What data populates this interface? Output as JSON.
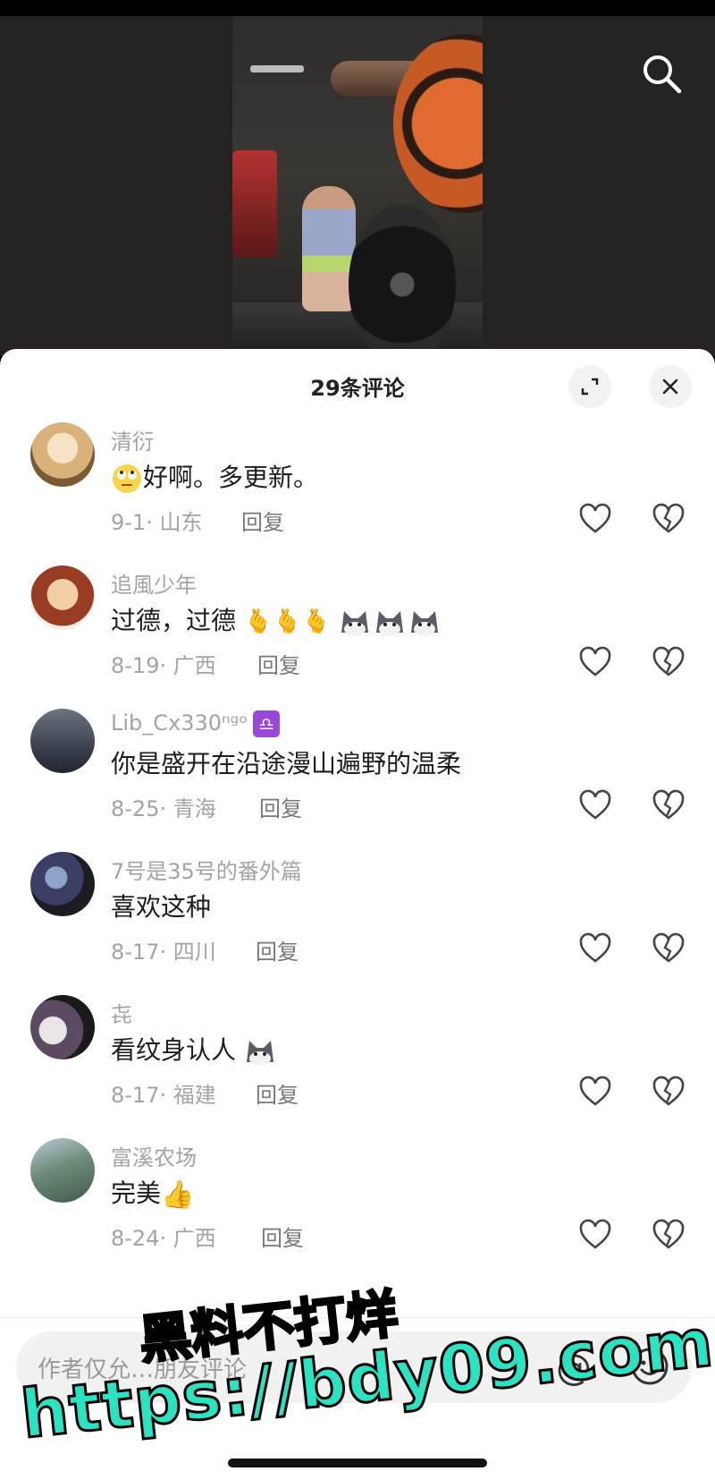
{
  "video": {
    "description_icon": "search-icon"
  },
  "sheet": {
    "title": "29条评论"
  },
  "comments": [
    {
      "username": "清衍",
      "text": "好啊。多更新。",
      "date": "9-1",
      "location": "山东",
      "reply": "回复"
    },
    {
      "username": "追風少年",
      "text": "过德，过德",
      "date": "8-19",
      "location": "广西",
      "reply": "回复"
    },
    {
      "username": "Lib_Cx330ⁿᵍᵒ",
      "text": "你是盛开在沿途漫山遍野的温柔",
      "date": "8-25",
      "location": "青海",
      "reply": "回复",
      "badge": "♎"
    },
    {
      "username": "7号是35号的番外篇",
      "text": "喜欢这种",
      "date": "8-17",
      "location": "四川",
      "reply": "回复"
    },
    {
      "username": "㐂",
      "text": "看纹身认人",
      "date": "8-17",
      "location": "福建",
      "reply": "回复"
    },
    {
      "username": "富溪农场",
      "text": "完美",
      "date": "8-24",
      "location": "广西",
      "reply": "回复"
    }
  ],
  "input": {
    "placeholder": "作者仅允…朋友评论",
    "at": "@"
  },
  "watermark": {
    "line1": "黑料不打烊",
    "line2": "https://bdy09.com"
  },
  "colors": {
    "accent_watermark": "#29e3c3",
    "sheet_bg": "#ffffff",
    "muted_text": "#a3a3a3"
  }
}
